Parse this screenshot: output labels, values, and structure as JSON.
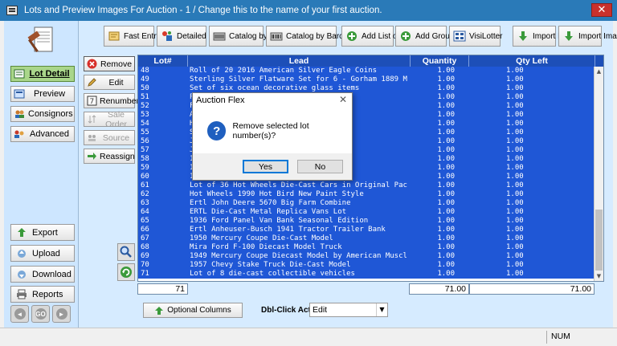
{
  "window": {
    "title": "Lots and Preview Images For Auction  -  1 / Change this to the name of your first auction.",
    "close_glyph": "✕"
  },
  "left_nav": {
    "items": [
      {
        "label": "Lot Detail",
        "icon": "lot-detail-icon",
        "active": true
      },
      {
        "label": "Preview",
        "icon": "preview-icon"
      },
      {
        "label": "Consignors",
        "icon": "consignors-icon"
      },
      {
        "label": "Advanced",
        "icon": "advanced-icon"
      }
    ],
    "lower": [
      {
        "label": "Export",
        "icon": "export-icon"
      },
      {
        "label": "Upload",
        "icon": "upload-icon"
      },
      {
        "label": "Download",
        "icon": "download-icon"
      },
      {
        "label": "Reports",
        "icon": "printer-icon"
      }
    ],
    "round_buttons": [
      "◄",
      "GO",
      "►"
    ]
  },
  "toolbar": [
    {
      "label": "Fast Entry",
      "icon": "fast-entry-icon"
    },
    {
      "label": "Detailed Entry",
      "icon": "detailed-entry-icon"
    },
    {
      "label": "Catalog by Images",
      "icon": "catalog-images-icon"
    },
    {
      "label": "Catalog by Barcode Images",
      "icon": "barcode-icon"
    },
    {
      "label": "Add List of Inventory#",
      "icon": "add-list-icon"
    },
    {
      "label": "Add Group from List",
      "icon": "add-group-icon"
    },
    {
      "label": "VisiLotter",
      "icon": "visilotter-icon"
    },
    {
      "label": "Import Lots",
      "icon": "import-lots-icon"
    },
    {
      "label": "Import Images",
      "icon": "import-images-icon"
    }
  ],
  "side_actions": [
    {
      "label": "Remove",
      "icon": "remove-icon",
      "disabled": false,
      "pressed": true
    },
    {
      "label": "Edit",
      "icon": "edit-icon",
      "disabled": false
    },
    {
      "label": "Renumber",
      "icon": "renumber-icon",
      "disabled": false
    },
    {
      "label": "Sale Order",
      "icon": "sale-order-icon",
      "disabled": true
    },
    {
      "label": "Source",
      "icon": "source-icon",
      "disabled": true
    },
    {
      "label": "Reassign",
      "icon": "reassign-icon",
      "disabled": false
    }
  ],
  "grid": {
    "columns": [
      "Lot#",
      "Lead",
      "Quantity",
      "Qty Left"
    ],
    "rows": [
      {
        "lot": "48",
        "lead": "Roll of 20 2016 American Silver Eagle Coins",
        "qty": "1.00",
        "left": "1.00"
      },
      {
        "lot": "49",
        "lead": "Sterling Silver Flatware Set for 6 - Gorham 1889 M",
        "qty": "1.00",
        "left": "1.00"
      },
      {
        "lot": "50",
        "lead": "Set of six ocean decorative glass items",
        "qty": "1.00",
        "left": "1.00"
      },
      {
        "lot": "51",
        "lead": "P                                  klaces, Brace",
        "qty": "1.00",
        "left": "1.00"
      },
      {
        "lot": "52",
        "lead": "F",
        "qty": "1.00",
        "left": "1.00"
      },
      {
        "lot": "53",
        "lead": "A                                  eedlepoint up",
        "qty": "1.00",
        "left": "1.00"
      },
      {
        "lot": "54",
        "lead": "H                                  cailed carvin",
        "qty": "1.00",
        "left": "1.00"
      },
      {
        "lot": "55",
        "lead": "S                                  y & Co., 188",
        "qty": "1.00",
        "left": "1.00"
      },
      {
        "lot": "56",
        "lead": "J",
        "qty": "1.00",
        "left": "1.00"
      },
      {
        "lot": "57",
        "lead": "J                                  ers Pair",
        "qty": "1.00",
        "left": "1.00"
      },
      {
        "lot": "58",
        "lead": "1                                  SA 6",
        "qty": "1.00",
        "left": "1.00"
      },
      {
        "lot": "59",
        "lead": "1                                  C",
        "qty": "1.00",
        "left": "1.00"
      },
      {
        "lot": "60",
        "lead": "1                                  A 2",
        "qty": "1.00",
        "left": "1.00"
      },
      {
        "lot": "61",
        "lead": "Lot of 36 Hot Wheels Die-Cast Cars in Original Pac",
        "qty": "1.00",
        "left": "1.00"
      },
      {
        "lot": "62",
        "lead": "Hot Wheels 1990 Hot Bird New Paint Style",
        "qty": "1.00",
        "left": "1.00"
      },
      {
        "lot": "63",
        "lead": "Ertl John Deere 5670 Big Farm Combine",
        "qty": "1.00",
        "left": "1.00"
      },
      {
        "lot": "64",
        "lead": "ERTL Die-Cast Metal Replica Vans Lot",
        "qty": "1.00",
        "left": "1.00"
      },
      {
        "lot": "65",
        "lead": "1936 Ford Panel Van Bank Seasonal Edition",
        "qty": "1.00",
        "left": "1.00"
      },
      {
        "lot": "66",
        "lead": "Ertl Anheuser-Busch 1941 Tractor Trailer Bank",
        "qty": "1.00",
        "left": "1.00"
      },
      {
        "lot": "67",
        "lead": "1950 Mercury Coupe Die-Cast Model",
        "qty": "1.00",
        "left": "1.00"
      },
      {
        "lot": "68",
        "lead": "Mira Ford F-100 Diecast Model Truck",
        "qty": "1.00",
        "left": "1.00"
      },
      {
        "lot": "69",
        "lead": "1949 Mercury Coupe Diecast Model by American Muscl",
        "qty": "1.00",
        "left": "1.00"
      },
      {
        "lot": "70",
        "lead": "1957 Chevy Stake Truck Die-Cast Model",
        "qty": "1.00",
        "left": "1.00"
      },
      {
        "lot": "71",
        "lead": "Lot of 8 die-cast collectible vehicles",
        "qty": "1.00",
        "left": "1.00"
      }
    ],
    "totals": {
      "lot_count": "71",
      "quantity": "71.00",
      "qty_left": "71.00"
    }
  },
  "bottom": {
    "optional_columns_label": "Optional Columns",
    "dblclick_label": "Dbl-Click Action",
    "dblclick_value": "Edit"
  },
  "statusbar": {
    "num": "NUM"
  },
  "dialog": {
    "title": "Auction Flex",
    "message": "Remove selected lot number(s)?",
    "yes": "Yes",
    "no": "No",
    "icon_glyph": "?",
    "close_glyph": "✕"
  },
  "colors": {
    "titlebar": "#2a7ab8",
    "selection": "#1f57d6",
    "header": "#1d4fb8",
    "active_nav": "#a9d68a",
    "panel_bg": "#cde6ff"
  }
}
